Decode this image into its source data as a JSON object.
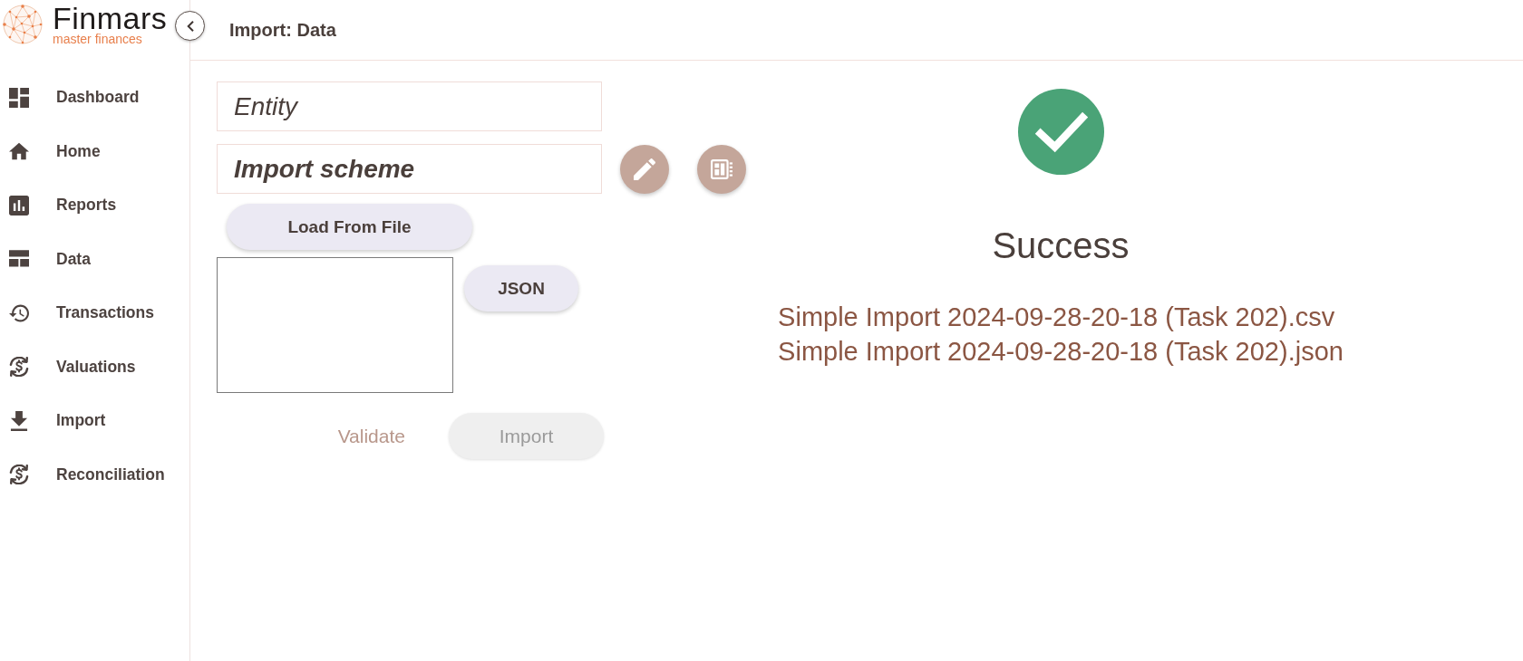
{
  "sidebar": {
    "logo": {
      "wordmark": "Finmars",
      "tagline": "master finances"
    },
    "items": [
      {
        "label": "Dashboard",
        "selected": false
      },
      {
        "label": "Home",
        "selected": false
      },
      {
        "label": "Reports",
        "selected": false
      },
      {
        "label": "Data",
        "selected": false
      },
      {
        "label": "Transactions",
        "selected": false
      },
      {
        "label": "Valuations",
        "selected": false
      },
      {
        "label": "Import",
        "selected": false
      },
      {
        "label": "Reconciliation",
        "selected": false
      }
    ]
  },
  "header": {
    "title": "Import: Data"
  },
  "form": {
    "fields": [
      {
        "placeholder": "Entity",
        "kind": "normal"
      },
      {
        "placeholder": "Import scheme",
        "kind": "strong"
      }
    ],
    "load_button": "Load From File",
    "format_button": "JSON",
    "actions": [
      {
        "kind": "text",
        "label": "Validate",
        "disabled": true
      },
      {
        "kind": "contained",
        "label": "Import",
        "disabled": true
      }
    ]
  },
  "result": {
    "status": "Success",
    "files": [
      "Simple Import 2024-09-28-20-18 (Task 202).csv",
      "Simple Import 2024-09-28-20-18 (Task 202).json"
    ]
  }
}
